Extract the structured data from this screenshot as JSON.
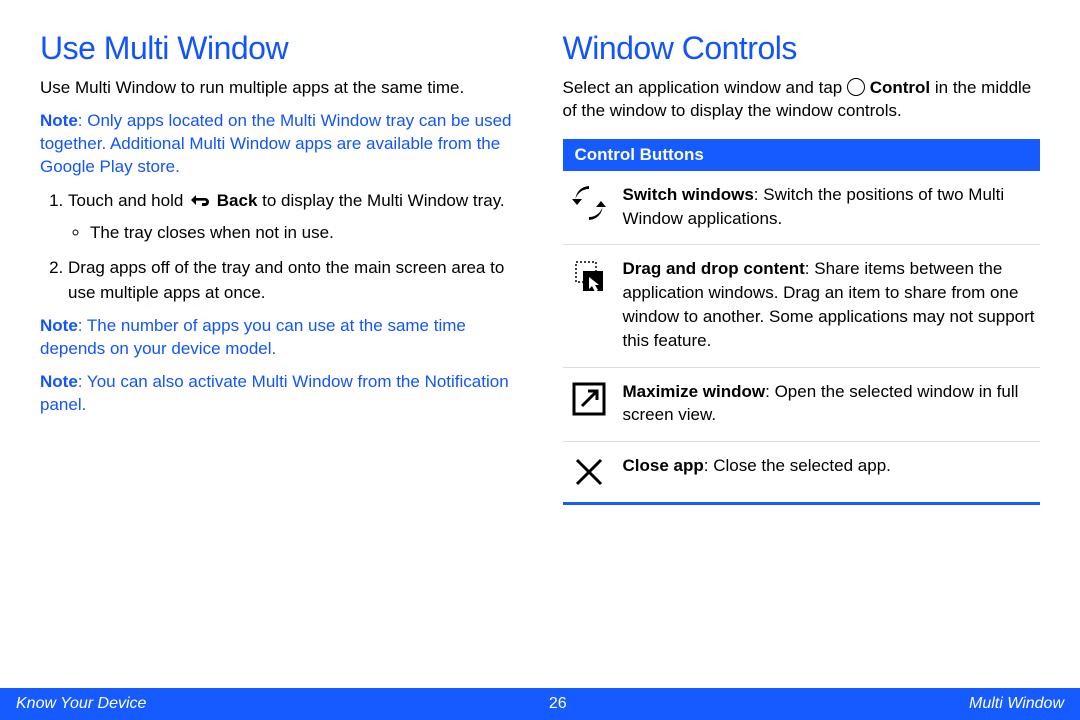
{
  "left": {
    "heading": "Use Multi Window",
    "intro": "Use Multi Window to run multiple apps at the same time.",
    "note1_label": "Note",
    "note1_body": ": Only apps located on the Multi Window tray can be used together. Additional Multi Window apps are available from the Google Play store.",
    "step1_a": "Touch and hold ",
    "step1_back_label": "Back",
    "step1_b": " to display the Multi Window tray.",
    "step1_bullet": "The tray closes when not in use.",
    "step2": "Drag apps off of the tray and onto the main screen area to use multiple apps at once.",
    "note2_label": "Note",
    "note2_body": ": The number of apps you can use at the same time depends on your device model.",
    "note3_label": "Note",
    "note3_body": ": You can also activate Multi Window from the Notification panel."
  },
  "right": {
    "heading": "Window Controls",
    "intro_a": "Select an application window and tap ",
    "intro_ctrl": "Control",
    "intro_b": " in the middle of the window to display the window controls.",
    "section": "Control Buttons",
    "rows": [
      {
        "title": "Switch windows",
        "body": ": Switch the positions of two Multi Window applications."
      },
      {
        "title": "Drag and drop content",
        "body": ": Share items between the application windows. Drag an item to share from one window to another. Some applications may not support this feature."
      },
      {
        "title": "Maximize window",
        "body": ": Open the selected window in full screen view."
      },
      {
        "title": "Close app",
        "body": ": Close the selected app."
      }
    ]
  },
  "footer": {
    "left": "Know Your Device",
    "center": "26",
    "right": "Multi Window"
  }
}
